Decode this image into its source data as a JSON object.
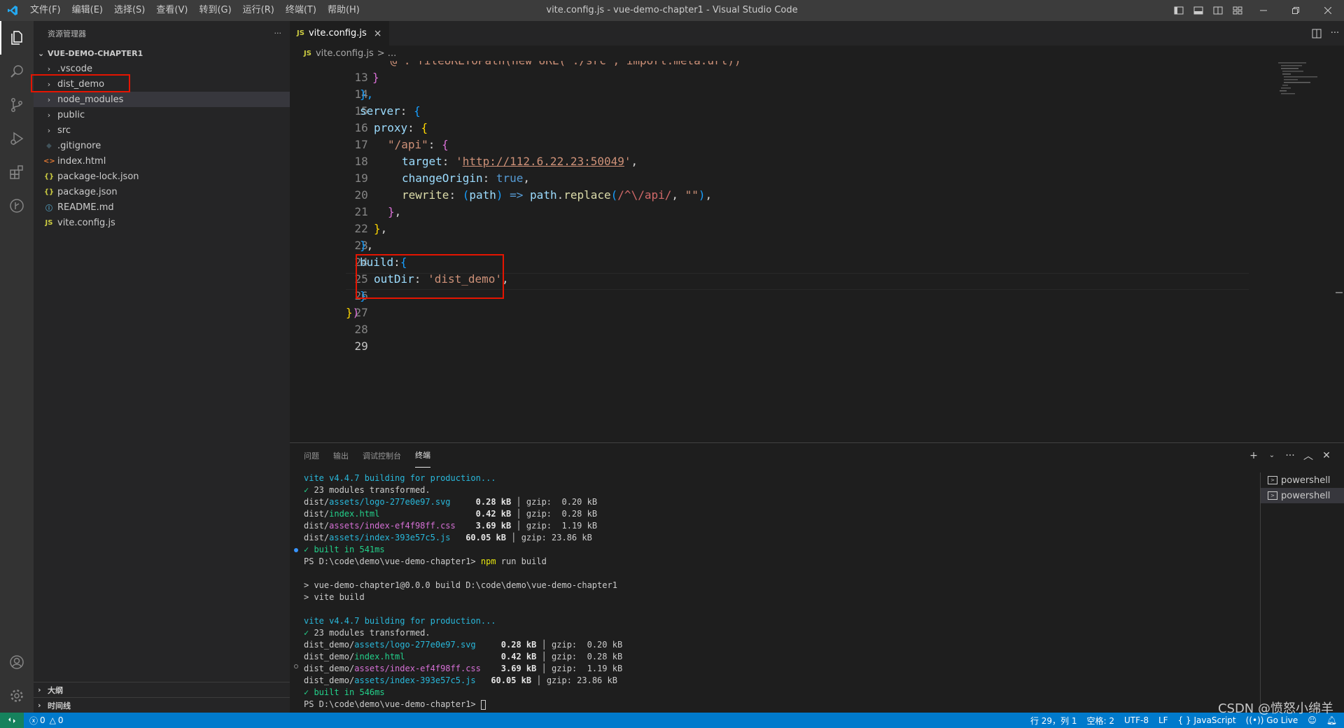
{
  "app": {
    "window_title": "vite.config.js - vue-demo-chapter1 - Visual Studio Code",
    "menu": [
      "文件(F)",
      "编辑(E)",
      "选择(S)",
      "查看(V)",
      "转到(G)",
      "运行(R)",
      "终端(T)",
      "帮助(H)"
    ]
  },
  "sidebar": {
    "header": "资源管理器",
    "more": "···",
    "project": "VUE-DEMO-CHAPTER1",
    "items": [
      {
        "label": ".vscode",
        "kind": "folder"
      },
      {
        "label": "dist_demo",
        "kind": "folder"
      },
      {
        "label": "node_modules",
        "kind": "folder"
      },
      {
        "label": "public",
        "kind": "folder"
      },
      {
        "label": "src",
        "kind": "folder"
      },
      {
        "label": ".gitignore",
        "kind": "git"
      },
      {
        "label": "index.html",
        "kind": "html"
      },
      {
        "label": "package-lock.json",
        "kind": "json"
      },
      {
        "label": "package.json",
        "kind": "json"
      },
      {
        "label": "README.md",
        "kind": "info"
      },
      {
        "label": "vite.config.js",
        "kind": "js"
      }
    ],
    "outline": "大纲",
    "timeline": "时间线"
  },
  "editor": {
    "tab_icon": "JS",
    "tab_label": "vite.config.js",
    "close": "×",
    "breadcrumb_file": "vite.config.js",
    "breadcrumb_rest": "> ...",
    "lines": {
      "l13": "'@': fileURLToPath(new URL('./src', import.meta.url))",
      "l14": "}",
      "l15": "},",
      "l16_key": "server",
      "l17_key": "proxy",
      "l18_key": "\"/api\"",
      "l19_key": "target",
      "l19_val": "'http://112.6.22.23:50049'",
      "l20_key": "changeOrigin",
      "l20_val": "true",
      "l21_key": "rewrite",
      "l21_param": "path",
      "l21_fn": "replace",
      "l21_regex": "/^\\/api/",
      "l21_str": "\"\"",
      "l25_key": "build",
      "l26_key": "outDir",
      "l26_val": "'dist_demo'"
    },
    "line_numbers": [
      "13",
      "14",
      "15",
      "16",
      "17",
      "18",
      "19",
      "20",
      "21",
      "22",
      "23",
      "24",
      "25",
      "26",
      "27",
      "28",
      "29"
    ]
  },
  "panel": {
    "tabs": [
      "问题",
      "输出",
      "调试控制台",
      "终端"
    ],
    "active_tab": "终端",
    "terminal_lines": [
      {
        "kind": "vite",
        "text": "vite v4.4.7 building for production..."
      },
      {
        "kind": "ok",
        "text": "✓ 23 modules transformed."
      },
      {
        "kind": "file",
        "dir": "dist/",
        "name": "assets/logo-277e0e97.svg",
        "color": "cyan",
        "pad": "    ",
        "size": "0.28 kB",
        "gzip": "gzip:  0.20 kB"
      },
      {
        "kind": "file",
        "dir": "dist/",
        "name": "index.html",
        "color": "green",
        "pad": "                  ",
        "size": "0.42 kB",
        "gzip": "gzip:  0.28 kB"
      },
      {
        "kind": "file",
        "dir": "dist/",
        "name": "assets/index-ef4f98ff.css",
        "color": "mag",
        "pad": "   ",
        "size": "3.69 kB",
        "gzip": "gzip:  1.19 kB"
      },
      {
        "kind": "file",
        "dir": "dist/",
        "name": "assets/index-393e57c5.js",
        "color": "cyan",
        "pad": "   ",
        "size": "60.05 kB",
        "gzip": "gzip: 23.86 kB"
      },
      {
        "kind": "ok",
        "text": "✓ built in 541ms"
      },
      {
        "kind": "prompt",
        "text": "PS D:\\code\\demo\\vue-demo-chapter1> ",
        "cmd": "npm",
        "args": " run build"
      },
      {
        "kind": "blank",
        "text": ""
      },
      {
        "kind": "plain",
        "text": "> vue-demo-chapter1@0.0.0 build D:\\code\\demo\\vue-demo-chapter1"
      },
      {
        "kind": "plain",
        "text": "> vite build"
      },
      {
        "kind": "blank",
        "text": ""
      },
      {
        "kind": "vite",
        "text": "vite v4.4.7 building for production..."
      },
      {
        "kind": "ok",
        "text": "✓ 23 modules transformed."
      },
      {
        "kind": "file",
        "dir": "dist_demo/",
        "name": "assets/logo-277e0e97.svg",
        "color": "cyan",
        "pad": "    ",
        "size": "0.28 kB",
        "gzip": "gzip:  0.20 kB"
      },
      {
        "kind": "file",
        "dir": "dist_demo/",
        "name": "index.html",
        "color": "green",
        "pad": "                  ",
        "size": "0.42 kB",
        "gzip": "gzip:  0.28 kB"
      },
      {
        "kind": "file",
        "dir": "dist_demo/",
        "name": "assets/index-ef4f98ff.css",
        "color": "mag",
        "pad": "   ",
        "size": "3.69 kB",
        "gzip": "gzip:  1.19 kB"
      },
      {
        "kind": "file",
        "dir": "dist_demo/",
        "name": "assets/index-393e57c5.js",
        "color": "cyan",
        "pad": "   ",
        "size": "60.05 kB",
        "gzip": "gzip: 23.86 kB"
      },
      {
        "kind": "ok",
        "text": "✓ built in 546ms"
      },
      {
        "kind": "prompt_end",
        "text": "PS D:\\code\\demo\\vue-demo-chapter1> "
      }
    ],
    "terminals": [
      "powershell",
      "powershell"
    ]
  },
  "statusbar": {
    "errors": "0",
    "warnings": "0",
    "position": "行 29，列 1",
    "spaces": "空格: 2",
    "encoding": "UTF-8",
    "eol": "LF",
    "language": "{ } JavaScript",
    "golive": "Go Live"
  },
  "watermark": "CSDN @愤怒小绵羊",
  "colors": {
    "accent": "#007acc",
    "highlight_box": "#e51400"
  }
}
